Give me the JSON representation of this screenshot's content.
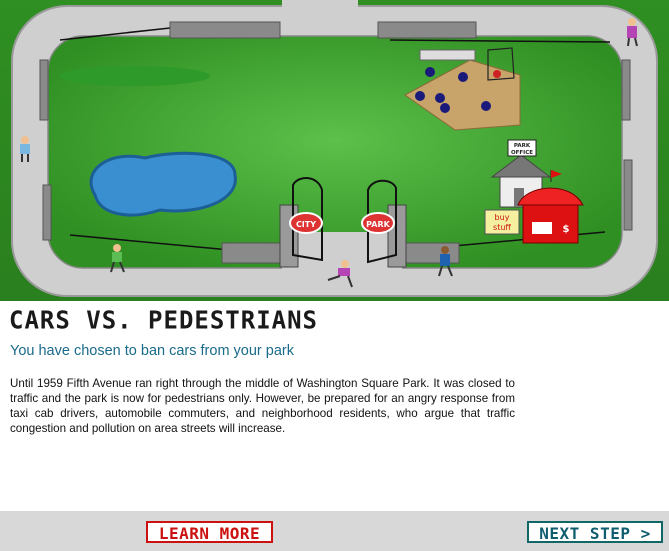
{
  "scene": {
    "gate_left_sign": "CITY",
    "gate_right_sign": "PARK",
    "office_sign_line1": "PARK",
    "office_sign_line2": "OFFICE",
    "stand_sign_line1": "buy",
    "stand_sign_line2": "stuff",
    "stand_symbol": "$"
  },
  "header": {
    "title": "Cars vs. Pedestrians",
    "subtitle": "You have chosen to ban cars from your park"
  },
  "body": {
    "text": "Until 1959 Fifth Avenue ran right through the middle of Washington Square Park. It was closed to traffic and the park is now for pedestrians only. However, be prepared for an angry response from taxi cab drivers, automobile commuters, and neighborhood residents, who argue that traffic congestion and pollution on area streets will increase."
  },
  "footer": {
    "learn_more_label": "LEARN MORE",
    "next_step_label": "NEXT STEP >"
  },
  "colors": {
    "grass": "#3ea82e",
    "path": "#cfcfcf",
    "pond": "#3a8fd0",
    "learn_more": "#cc1111",
    "next_step": "#0f5d6e"
  }
}
